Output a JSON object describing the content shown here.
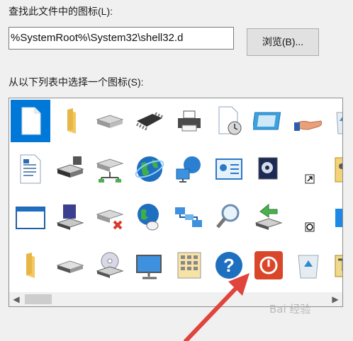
{
  "dialog": {
    "find_label": "查找此文件中的图标(L):",
    "path_value": "%SystemRoot%\\System32\\shell32.d",
    "browse_label": "浏览(B)...",
    "list_label": "从以下列表中选择一个图标(S):"
  },
  "icons": [
    [
      "document-icon",
      "folder-icon",
      "drive-icon",
      "chip-icon",
      "printer-icon",
      "clock-document-icon",
      "monitor-image-icon",
      "sharing-hand-icon",
      "recycle-bin-icon"
    ],
    [
      "text-document-icon",
      "network-drive-icon",
      "network-drive-share-icon",
      "globe-icon",
      "network-globe-icon",
      "control-panel-icon",
      "media-icon",
      "shortcut-arrow-icon",
      "open-folder-key-icon"
    ],
    [
      "window-icon",
      "disk-drive-icon",
      "network-drive-disconnect-icon",
      "globe-mouse-icon",
      "network-icon",
      "search-icon",
      "green-arrow-drive-icon",
      "clock-small-icon",
      "blue-square-icon"
    ],
    [
      "folder-icon",
      "hard-drive-icon",
      "cd-drive-icon",
      "desktop-monitor-icon",
      "keypad-icon",
      "help-icon",
      "power-icon",
      "recycle-bin-icon",
      "toolbox-icon"
    ]
  ],
  "selected_icon": "power-icon",
  "colors": {
    "selection": "#0078d7",
    "annotation_arrow": "#e0443c",
    "power_icon": "#d9462a"
  },
  "watermark": "Bai 经验"
}
